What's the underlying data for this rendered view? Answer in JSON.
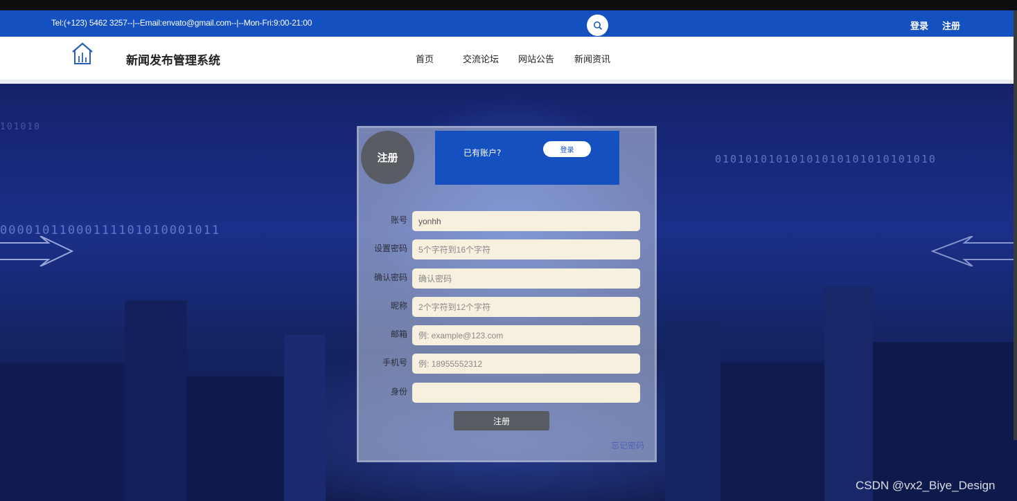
{
  "header": {
    "contact": "Tel:(+123) 5462 3257--|--Email:envato@gmail.com--|--Mon-Fri:9:00-21:00",
    "login_label": "登录",
    "register_label": "注册"
  },
  "nav": {
    "site_title": "新闻发布管理系统",
    "items": [
      "首页",
      "交流论坛",
      "网站公告",
      "新闻资讯"
    ]
  },
  "form": {
    "badge": "注册",
    "has_account": "已有账户?",
    "login_button": "登录",
    "fields": [
      {
        "label": "账号",
        "value": "yonhh",
        "placeholder": ""
      },
      {
        "label": "设置密码",
        "value": "",
        "placeholder": "5个字符到16个字符"
      },
      {
        "label": "确认密码",
        "value": "",
        "placeholder": "确认密码"
      },
      {
        "label": "昵称",
        "value": "",
        "placeholder": "2个字符到12个字符"
      },
      {
        "label": "邮箱",
        "value": "",
        "placeholder": "例: example@123.com"
      },
      {
        "label": "手机号",
        "value": "",
        "placeholder": "例: 18955552312"
      },
      {
        "label": "身份",
        "value": "",
        "placeholder": ""
      }
    ],
    "submit_label": "注册",
    "forgot_label": "忘记密码"
  },
  "decor": {
    "binary_left": "00001011000111101010001011",
    "binary_right": "01010101010101010101010101010",
    "binary_small": "101010"
  },
  "watermark": "CSDN @vx2_Biye_Design",
  "colors": {
    "brand_blue": "#1450c0",
    "button_gray": "#595b62",
    "input_bg": "#f8f0df"
  }
}
